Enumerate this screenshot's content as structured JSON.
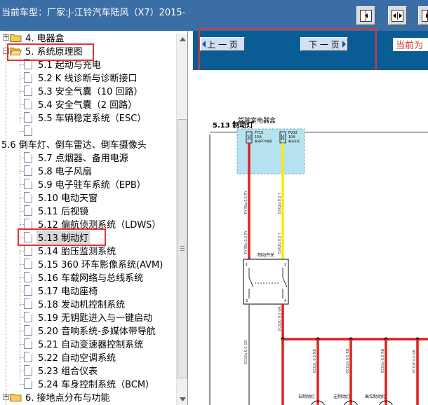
{
  "header": {
    "title": "当前车型：厂家:J-江铃汽车陆风（X7）2015-"
  },
  "toolbar": {
    "buttons": [
      {
        "name": "collapse-left-icon"
      },
      {
        "name": "fit-width-icon"
      },
      {
        "name": "collapse-right-icon"
      }
    ]
  },
  "tree": {
    "items": [
      {
        "label": "4. 电器盒",
        "type": "folder",
        "expander": "+"
      },
      {
        "label": "5. 系统原理图",
        "type": "folder-open",
        "expander": "-"
      },
      {
        "label": "5.1 起动与充电",
        "type": "page"
      },
      {
        "label": "5.2 K 线诊断与诊断接口",
        "type": "page"
      },
      {
        "label": "5.3 安全气囊（10 回路）",
        "type": "page"
      },
      {
        "label": "5.4 安全气囊（2 回路）",
        "type": "page"
      },
      {
        "label": "5.5 车辆稳定系统（ESC）",
        "type": "page"
      },
      {
        "label": "",
        "type": "page"
      },
      {
        "label": "5.6 倒车灯、倒车雷达、倒车摄像头",
        "type": "text"
      },
      {
        "label": "5.7 点烟器、备用电源",
        "type": "page"
      },
      {
        "label": "5.8 电子风扇",
        "type": "page"
      },
      {
        "label": "5.9 电子驻车系统（EPB）",
        "type": "page"
      },
      {
        "label": "5.10 电动天窗",
        "type": "page"
      },
      {
        "label": "5.11 后视镜",
        "type": "page"
      },
      {
        "label": "5.12 偏航侦测系统（LDWS）",
        "type": "page"
      },
      {
        "label": "5.13 制动灯",
        "type": "page",
        "selected": true
      },
      {
        "label": "5.14 胎压监测系统",
        "type": "page"
      },
      {
        "label": "5.15 360 环车影像系统(AVM)",
        "type": "page"
      },
      {
        "label": "5.16 车载网络与总线系统",
        "type": "page"
      },
      {
        "label": "5.17 电动座椅",
        "type": "page"
      },
      {
        "label": "5.18 发动机控制系统",
        "type": "page"
      },
      {
        "label": "5.19 无钥匙进入与一键启动",
        "type": "page"
      },
      {
        "label": "5.20 音响系统-多媒体带导航",
        "type": "page"
      },
      {
        "label": "5.21 自动变速器控制系统",
        "type": "page"
      },
      {
        "label": "5.22 自动空调系统",
        "type": "page"
      },
      {
        "label": "5.23 组合仪表",
        "type": "page"
      },
      {
        "label": "5.24 车身控制系统（BCM）",
        "type": "page"
      },
      {
        "label": "6. 接地点分布与功能",
        "type": "folder",
        "expander": "+"
      }
    ]
  },
  "nav": {
    "prev_label": "上 一 页",
    "next_label": "下 一 页",
    "current_label": "当前为"
  },
  "doc": {
    "section_title": "5.13 制动灯",
    "box_title": "驾驶室电器盒",
    "fuse1": {
      "id": "FY15",
      "rating": "15A",
      "desc": "制动ECU电源"
    },
    "fuse2": {
      "id": "FV02",
      "rating": "10A",
      "desc": "制动开关"
    },
    "wire_labels": [
      "EY35a 0.5 RY",
      "EV02a 0.5 Y",
      "EY35b 0.5 RY",
      "EV02b 0.5 Y",
      "EC02a 0.5 GR",
      "EC02b 0.5 GR"
    ],
    "switch_label": "制动开关",
    "switch_pins": [
      "1",
      "2",
      "3",
      "4"
    ],
    "bottom_wires": [
      "EC02c 0.5 RB",
      "EC02d 0.5 RB",
      "EC02e 0.5 RB",
      "EC02f 0.5 RB"
    ],
    "bottom_labels": [
      "右制动灯",
      "左制动灯",
      "高位制动灯",
      ""
    ]
  },
  "colors": {
    "header_bg": "#3a6ea5",
    "nav_bg": "#0a5d94",
    "highlight": "#e53333",
    "fusebox_bg": "#b7e2ef",
    "wire_red": "#e02020",
    "wire_yellow": "#ffe800"
  }
}
